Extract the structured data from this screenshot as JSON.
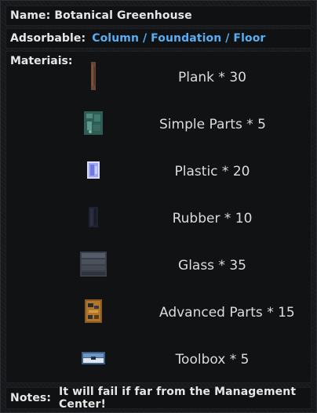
{
  "name": {
    "label": "Name:",
    "value": "Botanical Greenhouse"
  },
  "adsorbable": {
    "label": "Adsorbable:",
    "value": "Column / Foundation / Floor"
  },
  "materials": {
    "label": "Materiais:",
    "items": [
      {
        "icon": "plank-icon",
        "text": "Plank * 30"
      },
      {
        "icon": "simple-parts-icon",
        "text": "Simple Parts * 5"
      },
      {
        "icon": "plastic-icon",
        "text": "Plastic * 20"
      },
      {
        "icon": "rubber-icon",
        "text": "Rubber * 10"
      },
      {
        "icon": "glass-icon",
        "text": "Glass * 35"
      },
      {
        "icon": "advanced-parts-icon",
        "text": "Advanced Parts * 15"
      },
      {
        "icon": "toolbox-icon",
        "text": "Toolbox * 5"
      }
    ]
  },
  "notes": {
    "label": "Notes:",
    "value": "It will fail if far from the Management Center!"
  },
  "colors": {
    "accent": "#57aef2",
    "background": "#17181b",
    "text": "#e6e6e6"
  }
}
